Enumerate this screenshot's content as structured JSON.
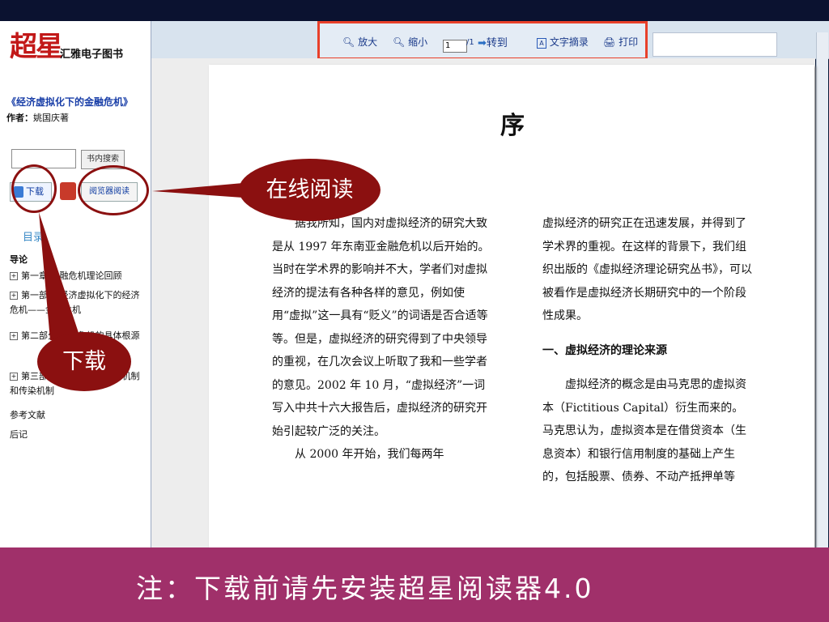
{
  "sidebar": {
    "logo_main": "超星",
    "logo_sub": "汇雅电子图书",
    "book_title": "《经济虚拟化下的金融危机》",
    "author_label": "作者：",
    "author_name": "姚国庆著",
    "search_button": "书内搜索",
    "download_button": "下载",
    "reader_button": "阅览器阅读",
    "toc_title": "目录",
    "toc_items": [
      {
        "label": "导论",
        "bold": true
      },
      {
        "label": "第一章  金融危机理论回顾"
      },
      {
        "label": "第一部分  经济虚拟化下的经济危机——金融危机"
      },
      {
        "label": "第二部分  金融危机的具体根源"
      },
      {
        "label": "第三部分  金融危机的传导机制和传染机制"
      },
      {
        "label": "参考文献"
      },
      {
        "label": "后记"
      }
    ]
  },
  "toolbar": {
    "zoom_in": "放大",
    "zoom_out": "缩小",
    "page_current": "1",
    "page_total": "/1",
    "goto": "转到",
    "text_extract": "文字摘录",
    "print": "打印"
  },
  "document": {
    "title": "序",
    "left_paragraphs": [
      "据我所知，国内对虚拟经济的研究大致是从 1997 年东南亚金融危机以后开始的。当时在学术界的影响并不大，学者们对虚拟经济的提法有各种各样的意见，例如使用“虚拟”这一具有“贬义”的词语是否合适等等。但是，虚拟经济的研究得到了中央领导的重视，在几次会议上听取了我和一些学者的意见。2002 年 10 月，“虚拟经济”一词写入中共十六大报告后，虚拟经济的研究开始引起较广泛的关注。",
      "从 2000 年开始，我们每两年"
    ],
    "right_paragraph_1": "虚拟经济的研究正在迅速发展，并得到了学术界的重视。在这样的背景下，我们组织出版的《虚拟经济理论研究丛书》，可以被看作是虚拟经济长期研究中的一个阶段性成果。",
    "right_section_title": "一、虚拟经济的理论来源",
    "right_paragraph_2": "虚拟经济的概念是由马克思的虚拟资本（Fictitious Capital）衍生而来的。马克思认为，虚拟资本是在借贷资本（生息资本）和银行信用制度的基础上产生的，包括股票、债券、不动产抵押单等"
  },
  "callouts": {
    "online_read": "在线阅读",
    "download": "下载"
  },
  "footer": {
    "note": "注：下载前请先安装超星阅读器4.0"
  },
  "colors": {
    "callout": "#8b1010",
    "footer": "#a0306a",
    "toolbar_border": "#e8402a",
    "link_blue": "#1a3fa8"
  }
}
